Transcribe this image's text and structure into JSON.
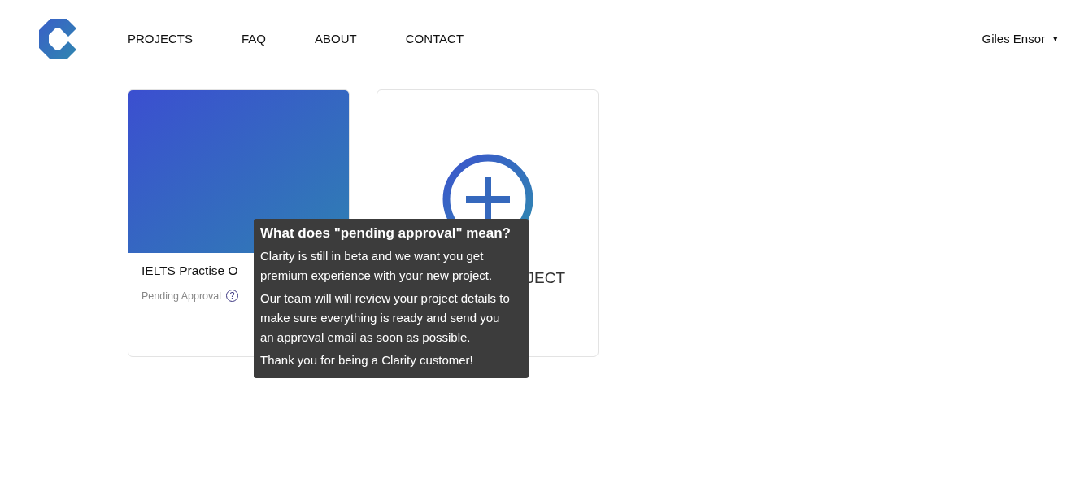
{
  "nav": {
    "items": [
      {
        "label": "PROJECTS"
      },
      {
        "label": "FAQ"
      },
      {
        "label": "ABOUT"
      },
      {
        "label": "CONTACT"
      }
    ],
    "user": {
      "name": "Giles Ensor",
      "caret": "▾"
    }
  },
  "projects": [
    {
      "kind": "project",
      "title": "IELTS Practise O",
      "status": "Pending Approval",
      "help": "?"
    },
    {
      "kind": "add",
      "label": "JECT"
    }
  ],
  "tooltip": {
    "title": "What does \"pending approval\" mean?",
    "paragraphs": [
      "Clarity is still in beta and we want you get premium experience with your new project.",
      "Our team will will review your project details to make sure everything is ready and send you an approval email as soon as possible.",
      "Thank you for being a Clarity customer!"
    ]
  }
}
